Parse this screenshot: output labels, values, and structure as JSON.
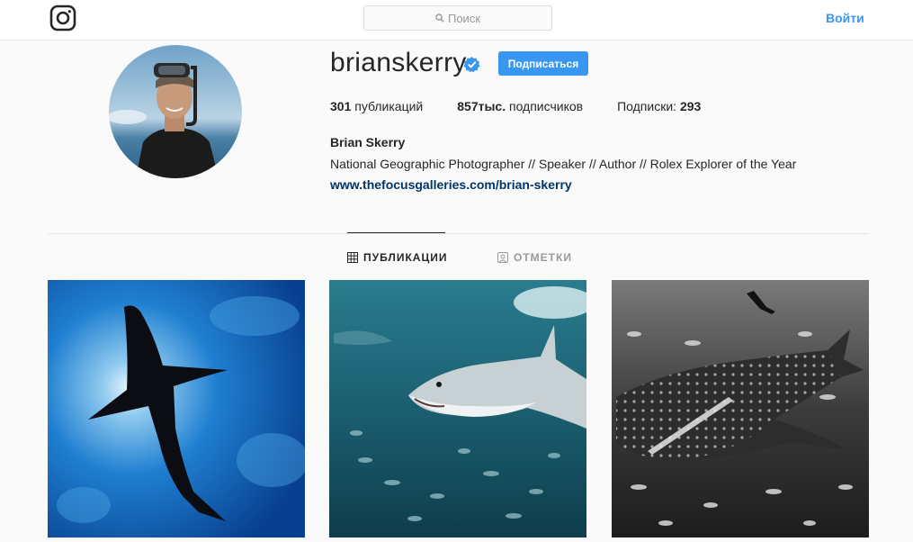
{
  "nav": {
    "search_placeholder": "Поиск",
    "login_label": "Войти"
  },
  "profile": {
    "username": "brianskerry",
    "follow_label": "Подписаться",
    "posts_count": "301",
    "posts_label": "публикаций",
    "followers_count": "857тыс.",
    "followers_label": "подписчиков",
    "following_label": "Подписки:",
    "following_count": "293",
    "full_name": "Brian Skerry",
    "bio": "National Geographic Photographer // Speaker // Author // Rolex Explorer of the Year",
    "website": "www.thefocusgalleries.com/brian-skerry"
  },
  "tabs": [
    {
      "label": "ПУБЛИКАЦИИ",
      "icon": "grid-icon",
      "active": true
    },
    {
      "label": "ОТМЕТКИ",
      "icon": "tag-icon",
      "active": false
    }
  ],
  "photos": [
    {
      "icon": "shark-silhouette-photo"
    },
    {
      "icon": "great-white-shark-photo"
    },
    {
      "icon": "whale-shark-photo"
    }
  ],
  "colors": {
    "accent": "#3897f0",
    "link": "#003569",
    "text": "#262626",
    "muted": "#999999"
  }
}
